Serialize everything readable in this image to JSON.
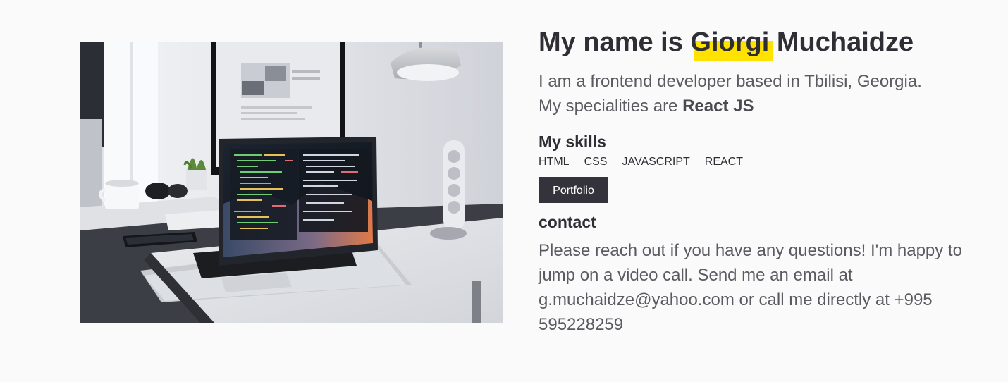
{
  "hero": {
    "title_prefix": "My name is ",
    "title_highlight": "Giorgi",
    "title_suffix": " Muchaidze",
    "highlight_color": "#ffe200",
    "intro_line1": "I am a frontend developer based in Tbilisi, Georgia.",
    "intro_line2_prefix": "My specialities are ",
    "intro_line2_strong": "React JS"
  },
  "skills": {
    "heading": "My skills",
    "items": [
      "HTML",
      "CSS",
      "JAVASCRIPT",
      "REACT"
    ]
  },
  "portfolio_button": {
    "label": "Portfolio",
    "color": "#34333b"
  },
  "contact": {
    "heading": "contact",
    "text": "Please reach out if you have any questions! I'm happy to jump on a video call. Send me an email at g.muchaidze@yahoo.com or call me directly at +995 595228259"
  },
  "photo": {
    "subject": "laptop-on-desk-photo"
  }
}
